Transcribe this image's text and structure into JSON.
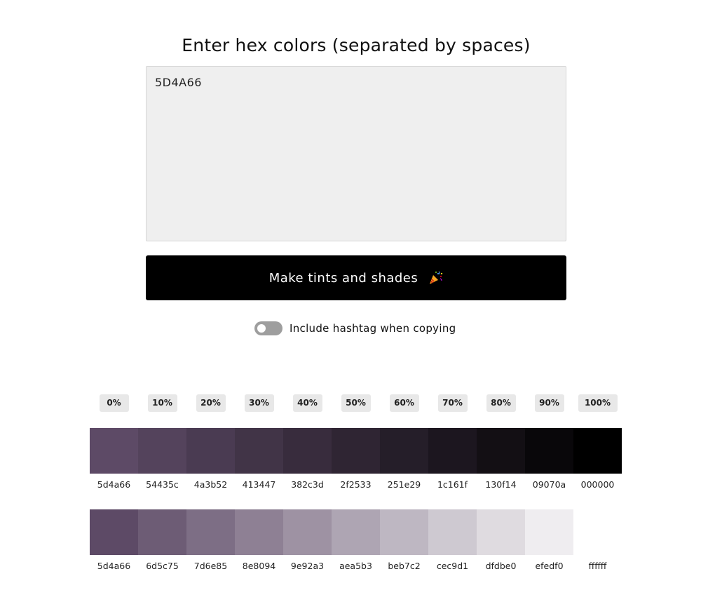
{
  "title": "Enter hex colors (separated by spaces)",
  "input": {
    "value": "5D4A66"
  },
  "button": {
    "label": "Make tints and shades",
    "icon": "party-popper-icon"
  },
  "toggle": {
    "label": "Include hashtag when copying",
    "checked": false
  },
  "percentages": [
    "0%",
    "10%",
    "20%",
    "30%",
    "40%",
    "50%",
    "60%",
    "70%",
    "80%",
    "90%",
    "100%"
  ],
  "shades": [
    "5d4a66",
    "54435c",
    "4a3b52",
    "413447",
    "382c3d",
    "2f2533",
    "251e29",
    "1c161f",
    "130f14",
    "09070a",
    "000000"
  ],
  "tints": [
    "5d4a66",
    "6d5c75",
    "7d6e85",
    "8e8094",
    "9e92a3",
    "aea5b3",
    "beb7c2",
    "cec9d1",
    "dfdbe0",
    "efedf0",
    "ffffff"
  ]
}
